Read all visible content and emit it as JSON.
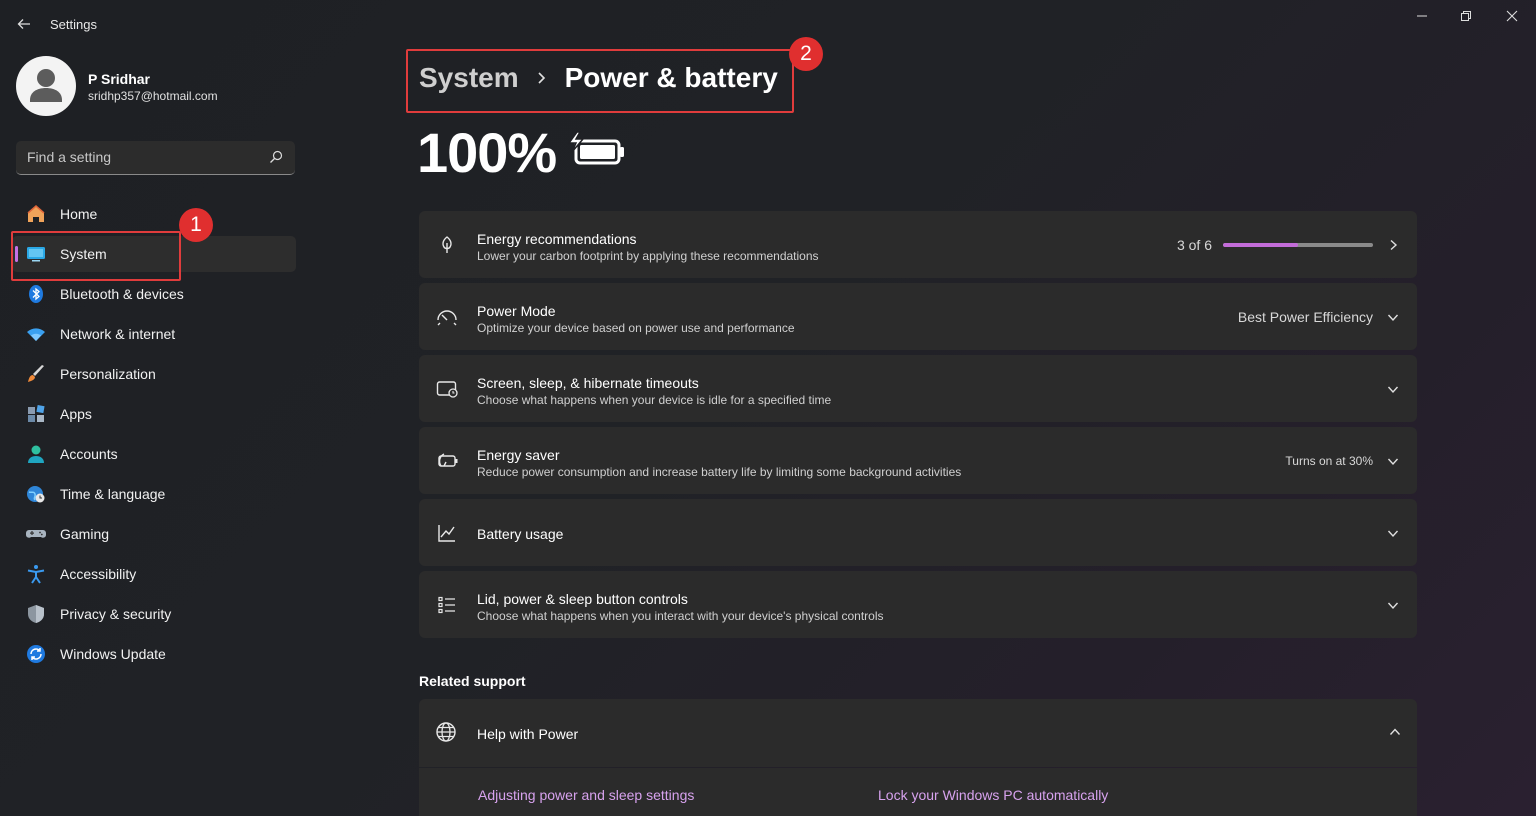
{
  "window": {
    "title": "Settings"
  },
  "profile": {
    "name": "P Sridhar",
    "email": "sridhp357@hotmail.com"
  },
  "search": {
    "placeholder": "Find a setting"
  },
  "nav": {
    "items": [
      {
        "label": "Home",
        "icon": "home-icon"
      },
      {
        "label": "System",
        "icon": "system-icon",
        "active": true
      },
      {
        "label": "Bluetooth & devices",
        "icon": "bluetooth-icon"
      },
      {
        "label": "Network & internet",
        "icon": "wifi-icon"
      },
      {
        "label": "Personalization",
        "icon": "brush-icon"
      },
      {
        "label": "Apps",
        "icon": "apps-icon"
      },
      {
        "label": "Accounts",
        "icon": "accounts-icon"
      },
      {
        "label": "Time & language",
        "icon": "globe-clock-icon"
      },
      {
        "label": "Gaming",
        "icon": "gamepad-icon"
      },
      {
        "label": "Accessibility",
        "icon": "accessibility-icon"
      },
      {
        "label": "Privacy & security",
        "icon": "shield-icon"
      },
      {
        "label": "Windows Update",
        "icon": "update-icon"
      }
    ]
  },
  "annotations": {
    "badge1": "1",
    "badge2": "2",
    "color": "#e02f2f"
  },
  "breadcrumb": {
    "parent": "System",
    "current": "Power & battery"
  },
  "battery": {
    "percent": "100%",
    "icon": "battery-charging-icon"
  },
  "cards": {
    "energy_rec": {
      "title": "Energy recommendations",
      "subtitle": "Lower your carbon footprint by applying these recommendations",
      "progress_text": "3 of 6",
      "progress_value": 0.5
    },
    "power_mode": {
      "title": "Power Mode",
      "subtitle": "Optimize your device based on power use and performance",
      "value": "Best Power Efficiency"
    },
    "screen_sleep": {
      "title": "Screen, sleep, & hibernate timeouts",
      "subtitle": "Choose what happens when your device is idle for a specified time"
    },
    "energy_saver": {
      "title": "Energy saver",
      "subtitle": "Reduce power consumption and increase battery life by limiting some background activities",
      "value": "Turns on at 30%"
    },
    "battery_usage": {
      "title": "Battery usage"
    },
    "lid_controls": {
      "title": "Lid, power & sleep button controls",
      "subtitle": "Choose what happens when you interact with your device's physical controls"
    }
  },
  "related": {
    "title": "Related support",
    "help": {
      "title": "Help with Power"
    },
    "links": [
      "Adjusting power and sleep settings",
      "Lock your Windows PC automatically"
    ]
  },
  "colors": {
    "accent": "#c471e6",
    "link": "#d7a2ee",
    "card": "#2b2b2b"
  }
}
